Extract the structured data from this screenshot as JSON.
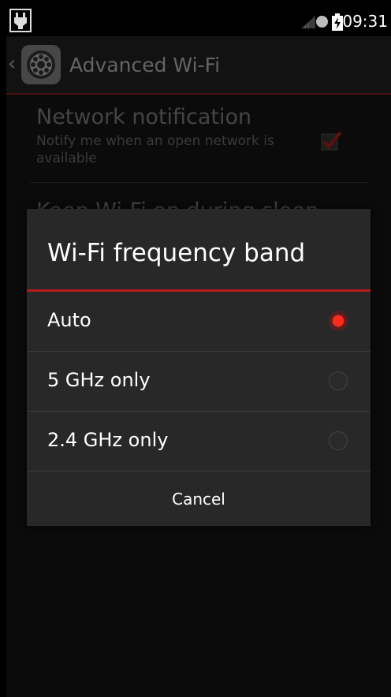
{
  "status_bar": {
    "time": "09:31",
    "icons": [
      "usb-debug-icon",
      "signal-icon",
      "sync-icon",
      "battery-charging-icon"
    ]
  },
  "action_bar": {
    "title": "Advanced Wi-Fi",
    "back_icon": "chevron-left-icon",
    "app_icon": "settings-gear-icon"
  },
  "settings": {
    "network_notification": {
      "title": "Network notification",
      "summary": "Notify me when an open network is available",
      "checked": true
    },
    "keep_wifi": {
      "title": "Keep Wi-Fi on during sleep"
    }
  },
  "dialog": {
    "title": "Wi-Fi frequency band",
    "options": [
      {
        "label": "Auto",
        "selected": true
      },
      {
        "label": "5 GHz only",
        "selected": false
      },
      {
        "label": "2.4 GHz only",
        "selected": false
      }
    ],
    "cancel_label": "Cancel"
  },
  "colors": {
    "accent": "#ff2a1e",
    "divider_red": "#b71c1c",
    "dialog_bg": "#282828"
  }
}
